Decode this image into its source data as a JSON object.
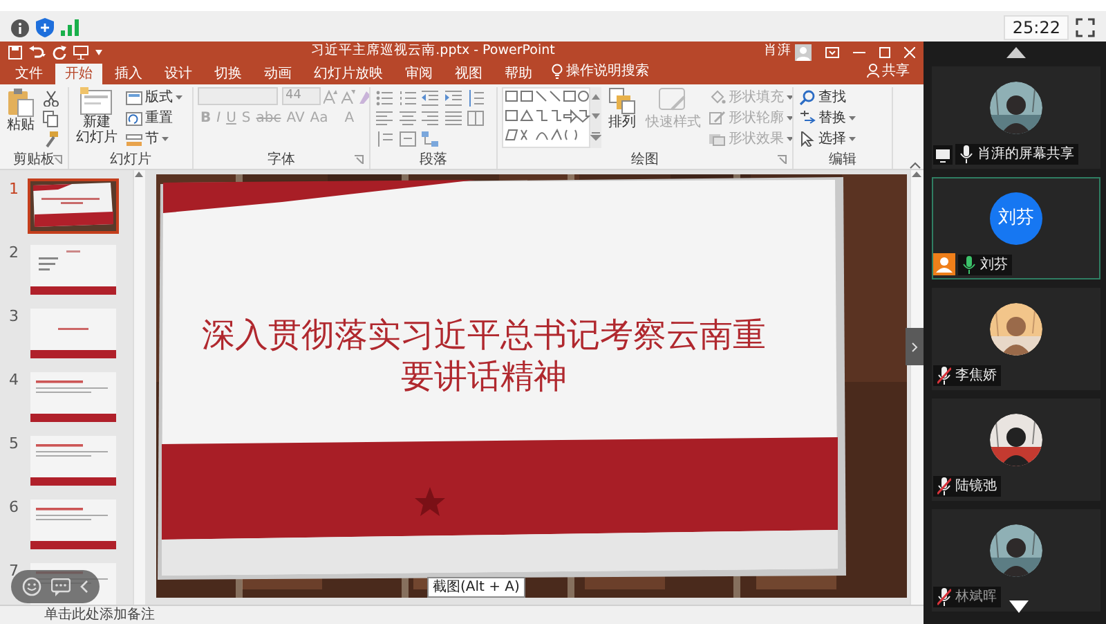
{
  "status_bar": {
    "time": "25:22"
  },
  "app": {
    "title": "习近平主席巡视云南.pptx - PowerPoint",
    "user": "肖湃",
    "tabs": [
      {
        "label": "文件",
        "selected": false
      },
      {
        "label": "开始",
        "selected": true
      },
      {
        "label": "插入",
        "selected": false
      },
      {
        "label": "设计",
        "selected": false
      },
      {
        "label": "切换",
        "selected": false
      },
      {
        "label": "动画",
        "selected": false
      },
      {
        "label": "幻灯片放映",
        "selected": false
      },
      {
        "label": "审阅",
        "selected": false
      },
      {
        "label": "视图",
        "selected": false
      },
      {
        "label": "帮助",
        "selected": false
      }
    ],
    "tell_me": "操作说明搜索",
    "share": "共享"
  },
  "ribbon": {
    "groups": [
      {
        "label": "剪贴板",
        "large": [
          {
            "lines": [
              "粘贴"
            ],
            "disabled": false
          }
        ]
      },
      {
        "label": "幻灯片",
        "large": [
          {
            "lines": [
              "新建",
              "幻灯片"
            ],
            "disabled": false
          }
        ],
        "small": [
          {
            "label": "版式",
            "disabled": false
          },
          {
            "label": "重置",
            "disabled": false
          },
          {
            "label": "节",
            "disabled": false
          }
        ]
      },
      {
        "label": "字体",
        "font_size": "44",
        "format": [
          "B",
          "I",
          "U",
          "S",
          "abc",
          "AV",
          "Aa",
          "A"
        ],
        "disabled": true
      },
      {
        "label": "段落"
      },
      {
        "label": "绘图",
        "large": [
          {
            "lines": [
              "排列"
            ],
            "disabled": false
          },
          {
            "lines": [
              "快速样式"
            ],
            "disabled": true
          }
        ],
        "small": [
          {
            "label": "形状填充",
            "disabled": true
          },
          {
            "label": "形状轮廓",
            "disabled": true
          },
          {
            "label": "形状效果",
            "disabled": true
          }
        ]
      },
      {
        "label": "编辑",
        "small": [
          {
            "label": "查找",
            "disabled": false
          },
          {
            "label": "替换",
            "disabled": false
          },
          {
            "label": "选择",
            "disabled": false
          }
        ]
      }
    ]
  },
  "thumbnails": [
    {
      "number": "1",
      "selected": true,
      "kind": "cover"
    },
    {
      "number": "2",
      "selected": false,
      "kind": "list"
    },
    {
      "number": "3",
      "selected": false,
      "kind": "title"
    },
    {
      "number": "4",
      "selected": false,
      "kind": "text"
    },
    {
      "number": "5",
      "selected": false,
      "kind": "text"
    },
    {
      "number": "6",
      "selected": false,
      "kind": "text"
    },
    {
      "number": "7",
      "selected": false,
      "kind": "text"
    }
  ],
  "slide": {
    "title": "深入贯彻落实习近平总书记考察云南重要讲话精神",
    "tooltip": "截图(Alt + A)"
  },
  "notes": {
    "placeholder": "单击此处添加备注"
  },
  "participants": [
    {
      "name": "肖湃的屏幕共享",
      "screen_sharing": true,
      "host": false,
      "muted": false,
      "speaking": false,
      "highlighted": false
    },
    {
      "name": "刘芬",
      "screen_sharing": false,
      "host": true,
      "muted": false,
      "speaking": true,
      "highlighted": true,
      "avatar": {
        "kind": "text",
        "text": "刘芬"
      }
    },
    {
      "name": "李焦娇",
      "screen_sharing": false,
      "host": false,
      "muted": true,
      "speaking": false,
      "highlighted": false
    },
    {
      "name": "陆镜弛",
      "screen_sharing": false,
      "host": false,
      "muted": true,
      "speaking": false,
      "highlighted": false
    },
    {
      "name": "林斌晖",
      "screen_sharing": false,
      "host": false,
      "muted": true,
      "speaking": false,
      "highlighted": false
    }
  ]
}
